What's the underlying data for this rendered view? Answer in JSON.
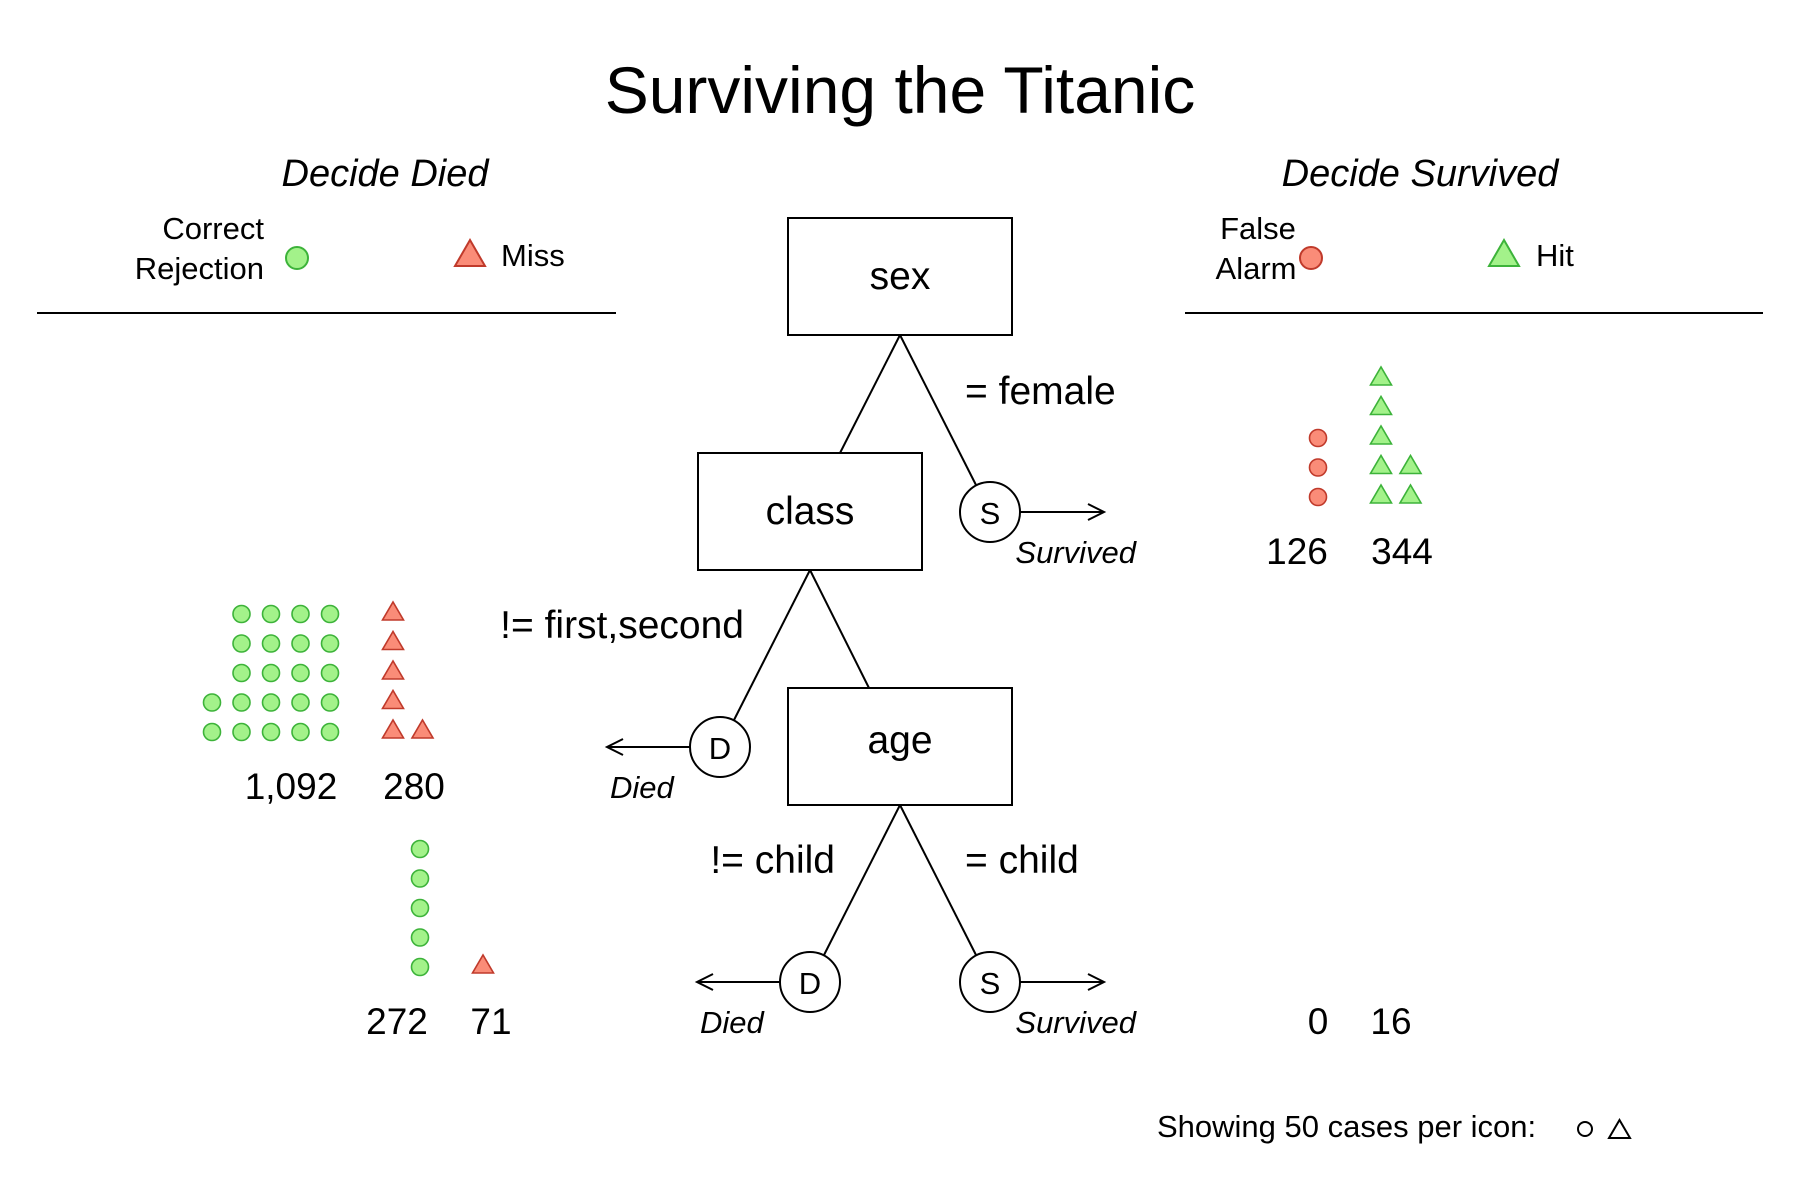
{
  "title": "Surviving the Titanic",
  "panels": {
    "left": {
      "heading": "Decide Died",
      "legend": [
        {
          "label_line1": "Correct",
          "label_line2": "Rejection",
          "icon": "circle",
          "color": "green"
        },
        {
          "label": "Miss",
          "icon": "triangle",
          "color": "red"
        }
      ]
    },
    "right": {
      "heading": "Decide Survived",
      "legend": [
        {
          "label_line1": "False",
          "label_line2": "Alarm",
          "icon": "circle",
          "color": "red"
        },
        {
          "label": "Hit",
          "icon": "triangle",
          "color": "green"
        }
      ]
    }
  },
  "colors": {
    "green_fill": "#A3F28A",
    "green_stroke": "#3DB33A",
    "red_fill": "#FA8C78",
    "red_stroke": "#C03A2B",
    "line": "#000000"
  },
  "tree": {
    "nodes": [
      {
        "id": "sex",
        "label": "sex"
      },
      {
        "id": "class",
        "label": "class"
      },
      {
        "id": "age",
        "label": "age"
      }
    ],
    "edges": [
      {
        "from": "sex",
        "to": "exit-1",
        "label": "= female"
      },
      {
        "from": "class",
        "to": "exit-2",
        "label": "!= first,second"
      },
      {
        "from": "age",
        "to": "exit-3",
        "label": "!= child"
      },
      {
        "from": "age",
        "to": "exit-4",
        "label": "= child"
      }
    ],
    "exits": [
      {
        "id": "exit-1",
        "letter": "S",
        "decision": "Survived"
      },
      {
        "id": "exit-2",
        "letter": "D",
        "decision": "Died"
      },
      {
        "id": "exit-3",
        "letter": "D",
        "decision": "Died"
      },
      {
        "id": "exit-4",
        "letter": "S",
        "decision": "Survived"
      }
    ]
  },
  "frequencies": [
    {
      "level": "sex",
      "side": "right",
      "false_alarm": 126,
      "hit": 344,
      "label_a": "126",
      "label_b": "344"
    },
    {
      "level": "class",
      "side": "left",
      "correct_rejection": 1092,
      "miss": 280,
      "label_a": "1,092",
      "label_b": "280"
    },
    {
      "level": "age-died",
      "side": "left",
      "correct_rejection": 272,
      "miss": 71,
      "label_a": "272",
      "label_b": "71"
    },
    {
      "level": "age-survived",
      "side": "right",
      "false_alarm": 0,
      "hit": 16,
      "label_a": "0",
      "label_b": "16"
    }
  ],
  "footer": {
    "text": "Showing 50 cases per icon:",
    "cases_per_icon": 50,
    "icons": [
      "circle",
      "triangle"
    ]
  }
}
